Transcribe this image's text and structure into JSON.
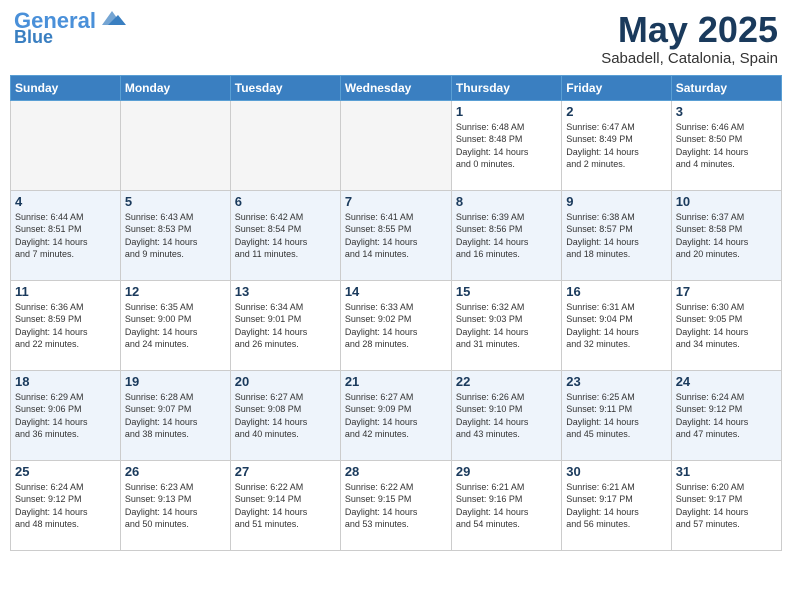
{
  "logo": {
    "line1": "General",
    "line2": "Blue"
  },
  "title": "May 2025",
  "subtitle": "Sabadell, Catalonia, Spain",
  "weekdays": [
    "Sunday",
    "Monday",
    "Tuesday",
    "Wednesday",
    "Thursday",
    "Friday",
    "Saturday"
  ],
  "weeks": [
    [
      {
        "num": "",
        "info": "",
        "empty": true
      },
      {
        "num": "",
        "info": "",
        "empty": true
      },
      {
        "num": "",
        "info": "",
        "empty": true
      },
      {
        "num": "",
        "info": "",
        "empty": true
      },
      {
        "num": "1",
        "info": "Sunrise: 6:48 AM\nSunset: 8:48 PM\nDaylight: 14 hours\nand 0 minutes.",
        "empty": false
      },
      {
        "num": "2",
        "info": "Sunrise: 6:47 AM\nSunset: 8:49 PM\nDaylight: 14 hours\nand 2 minutes.",
        "empty": false
      },
      {
        "num": "3",
        "info": "Sunrise: 6:46 AM\nSunset: 8:50 PM\nDaylight: 14 hours\nand 4 minutes.",
        "empty": false
      }
    ],
    [
      {
        "num": "4",
        "info": "Sunrise: 6:44 AM\nSunset: 8:51 PM\nDaylight: 14 hours\nand 7 minutes.",
        "empty": false
      },
      {
        "num": "5",
        "info": "Sunrise: 6:43 AM\nSunset: 8:53 PM\nDaylight: 14 hours\nand 9 minutes.",
        "empty": false
      },
      {
        "num": "6",
        "info": "Sunrise: 6:42 AM\nSunset: 8:54 PM\nDaylight: 14 hours\nand 11 minutes.",
        "empty": false
      },
      {
        "num": "7",
        "info": "Sunrise: 6:41 AM\nSunset: 8:55 PM\nDaylight: 14 hours\nand 14 minutes.",
        "empty": false
      },
      {
        "num": "8",
        "info": "Sunrise: 6:39 AM\nSunset: 8:56 PM\nDaylight: 14 hours\nand 16 minutes.",
        "empty": false
      },
      {
        "num": "9",
        "info": "Sunrise: 6:38 AM\nSunset: 8:57 PM\nDaylight: 14 hours\nand 18 minutes.",
        "empty": false
      },
      {
        "num": "10",
        "info": "Sunrise: 6:37 AM\nSunset: 8:58 PM\nDaylight: 14 hours\nand 20 minutes.",
        "empty": false
      }
    ],
    [
      {
        "num": "11",
        "info": "Sunrise: 6:36 AM\nSunset: 8:59 PM\nDaylight: 14 hours\nand 22 minutes.",
        "empty": false
      },
      {
        "num": "12",
        "info": "Sunrise: 6:35 AM\nSunset: 9:00 PM\nDaylight: 14 hours\nand 24 minutes.",
        "empty": false
      },
      {
        "num": "13",
        "info": "Sunrise: 6:34 AM\nSunset: 9:01 PM\nDaylight: 14 hours\nand 26 minutes.",
        "empty": false
      },
      {
        "num": "14",
        "info": "Sunrise: 6:33 AM\nSunset: 9:02 PM\nDaylight: 14 hours\nand 28 minutes.",
        "empty": false
      },
      {
        "num": "15",
        "info": "Sunrise: 6:32 AM\nSunset: 9:03 PM\nDaylight: 14 hours\nand 31 minutes.",
        "empty": false
      },
      {
        "num": "16",
        "info": "Sunrise: 6:31 AM\nSunset: 9:04 PM\nDaylight: 14 hours\nand 32 minutes.",
        "empty": false
      },
      {
        "num": "17",
        "info": "Sunrise: 6:30 AM\nSunset: 9:05 PM\nDaylight: 14 hours\nand 34 minutes.",
        "empty": false
      }
    ],
    [
      {
        "num": "18",
        "info": "Sunrise: 6:29 AM\nSunset: 9:06 PM\nDaylight: 14 hours\nand 36 minutes.",
        "empty": false
      },
      {
        "num": "19",
        "info": "Sunrise: 6:28 AM\nSunset: 9:07 PM\nDaylight: 14 hours\nand 38 minutes.",
        "empty": false
      },
      {
        "num": "20",
        "info": "Sunrise: 6:27 AM\nSunset: 9:08 PM\nDaylight: 14 hours\nand 40 minutes.",
        "empty": false
      },
      {
        "num": "21",
        "info": "Sunrise: 6:27 AM\nSunset: 9:09 PM\nDaylight: 14 hours\nand 42 minutes.",
        "empty": false
      },
      {
        "num": "22",
        "info": "Sunrise: 6:26 AM\nSunset: 9:10 PM\nDaylight: 14 hours\nand 43 minutes.",
        "empty": false
      },
      {
        "num": "23",
        "info": "Sunrise: 6:25 AM\nSunset: 9:11 PM\nDaylight: 14 hours\nand 45 minutes.",
        "empty": false
      },
      {
        "num": "24",
        "info": "Sunrise: 6:24 AM\nSunset: 9:12 PM\nDaylight: 14 hours\nand 47 minutes.",
        "empty": false
      }
    ],
    [
      {
        "num": "25",
        "info": "Sunrise: 6:24 AM\nSunset: 9:12 PM\nDaylight: 14 hours\nand 48 minutes.",
        "empty": false
      },
      {
        "num": "26",
        "info": "Sunrise: 6:23 AM\nSunset: 9:13 PM\nDaylight: 14 hours\nand 50 minutes.",
        "empty": false
      },
      {
        "num": "27",
        "info": "Sunrise: 6:22 AM\nSunset: 9:14 PM\nDaylight: 14 hours\nand 51 minutes.",
        "empty": false
      },
      {
        "num": "28",
        "info": "Sunrise: 6:22 AM\nSunset: 9:15 PM\nDaylight: 14 hours\nand 53 minutes.",
        "empty": false
      },
      {
        "num": "29",
        "info": "Sunrise: 6:21 AM\nSunset: 9:16 PM\nDaylight: 14 hours\nand 54 minutes.",
        "empty": false
      },
      {
        "num": "30",
        "info": "Sunrise: 6:21 AM\nSunset: 9:17 PM\nDaylight: 14 hours\nand 56 minutes.",
        "empty": false
      },
      {
        "num": "31",
        "info": "Sunrise: 6:20 AM\nSunset: 9:17 PM\nDaylight: 14 hours\nand 57 minutes.",
        "empty": false
      }
    ]
  ]
}
